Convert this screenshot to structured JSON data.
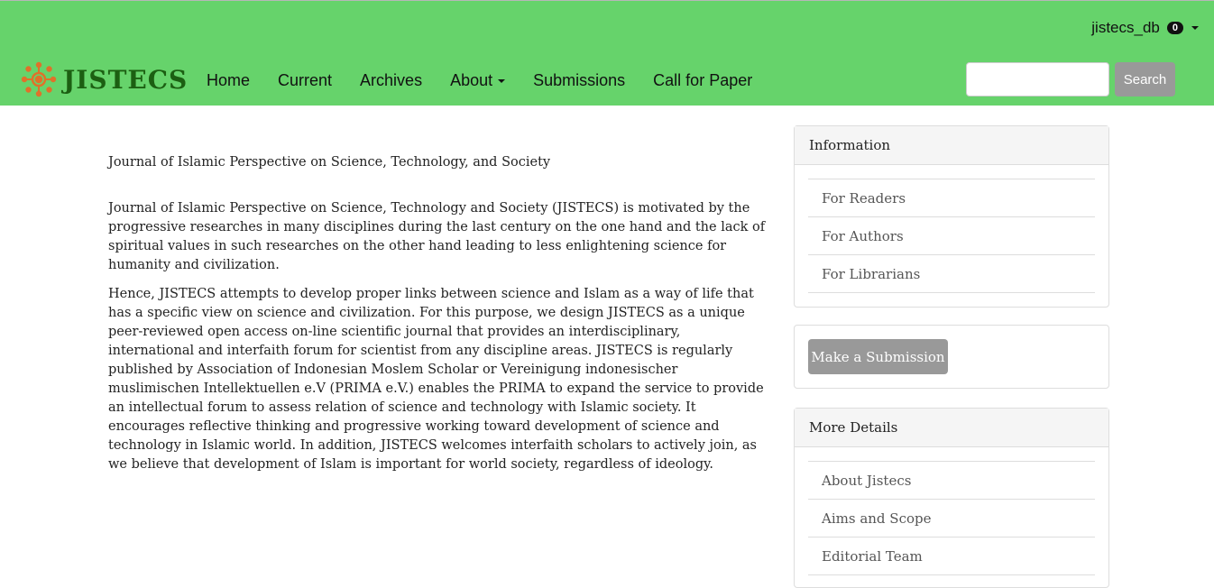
{
  "site": {
    "logo_text": "JISTECS"
  },
  "nav": {
    "items": [
      {
        "label": "Home"
      },
      {
        "label": "Current"
      },
      {
        "label": "Archives"
      },
      {
        "label": "About"
      },
      {
        "label": "Submissions"
      },
      {
        "label": "Call for Paper"
      }
    ]
  },
  "user": {
    "name": "jistecs_db",
    "notifications": "0"
  },
  "search": {
    "placeholder": "",
    "button_label": "Search"
  },
  "main": {
    "title": "Journal of Islamic Perspective on Science, Technology, and Society",
    "paragraphs": [
      "Journal of Islamic Perspective on Science, Technology and Society (JISTECS) is motivated by the progressive researches in many disciplines during the last century on the one hand and the lack of spiritual values in such researches on the other hand leading to less enlightening science for humanity and civilization.",
      "Hence, JISTECS attempts to develop proper links between science and Islam as a way of life that has a specific view on science and civilization. For this purpose, we design JISTECS as a unique peer-reviewed open access on-line scientific journal that provides an interdisciplinary, international and interfaith forum for scientist from any discipline areas. JISTECS is regularly published by Association of Indonesian Moslem Scholar or Vereinigung indonesischer muslimischen Intellektuellen e.V (PRIMA e.V.) enables the PRIMA to expand the service to provide an intellectual forum to assess relation of science and technology with Islamic society. It encourages reflective thinking and progressive working toward development of science and technology in Islamic world. In addition, JISTECS welcomes interfaith scholars to actively join, as we believe that development of Islam is important for world society, regardless of ideology."
    ]
  },
  "sidebar": {
    "information": {
      "heading": "Information",
      "items": [
        {
          "label": "For Readers"
        },
        {
          "label": "For Authors"
        },
        {
          "label": "For Librarians"
        }
      ]
    },
    "submission_button": "Make a Submission",
    "more_details": {
      "heading": "More Details",
      "items": [
        {
          "label": "About Jistecs"
        },
        {
          "label": "Aims and Scope"
        },
        {
          "label": "Editorial Team"
        }
      ]
    }
  },
  "colors": {
    "header_bg": "#66d36b",
    "logo_text": "#1c5f12",
    "logo_icon": "#e0712a",
    "button_gray": "#999999"
  }
}
